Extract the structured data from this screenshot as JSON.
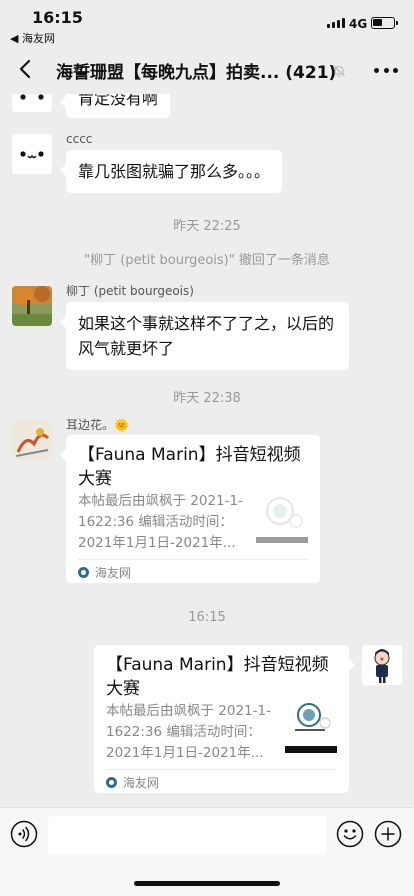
{
  "status_bar": {
    "time": "16:15",
    "back_app": "◀ 海友网",
    "network": "4G"
  },
  "nav": {
    "title": "海誓珊盟【每晚九点】拍卖... (421)"
  },
  "messages": {
    "m0": {
      "text": "肯定没有啊"
    },
    "m1": {
      "nick": "cccc",
      "text": "靠几张图就骗了那么多。。。"
    },
    "stamp1": "昨天 22:25",
    "recall": "\"柳丁 (petit bourgeois)\" 撤回了一条消息",
    "m2": {
      "nick": "柳丁 (petit bourgeois)",
      "text": "如果这个事就这样不了了之，以后的风气就更坏了"
    },
    "stamp2": "昨天 22:38",
    "m3": {
      "nick": "耳边花。🌞",
      "card_title": "【Fauna Marin】抖音短视频大赛",
      "card_desc": "本帖最后由飒枫于 2021-1-1622:36 编辑活动时间：2021年1月1日-2021年...",
      "card_source": "海友网"
    },
    "stamp3": "16:15",
    "m4": {
      "card_title": "【Fauna Marin】抖音短视频大赛",
      "card_desc": "本帖最后由飒枫于 2021-1-1622:36 编辑活动时间：2021年1月1日-2021年...",
      "card_source": "海友网"
    }
  },
  "input": {
    "placeholder": ""
  },
  "icons": {
    "back": "chevron-left-icon",
    "mute": "mute-bell-icon",
    "more": "more-dots-icon",
    "voice": "voice-icon",
    "emoji": "emoji-icon",
    "plus": "plus-icon"
  }
}
